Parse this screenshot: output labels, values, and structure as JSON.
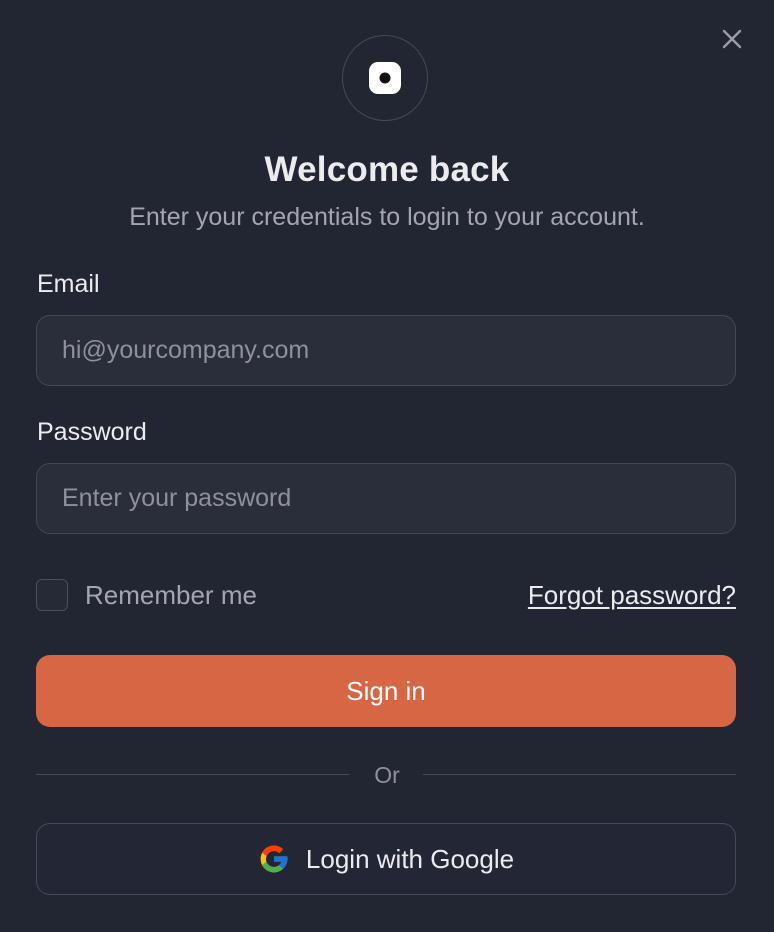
{
  "dialog": {
    "title": "Welcome back",
    "subtitle": "Enter your credentials to login to your account.",
    "close_icon": "close-icon",
    "logo_icon": "logo-icon"
  },
  "form": {
    "email": {
      "label": "Email",
      "value": "",
      "placeholder": "hi@yourcompany.com"
    },
    "password": {
      "label": "Password",
      "value": "",
      "placeholder": "Enter your password"
    },
    "remember_me": {
      "label": "Remember me",
      "checked": false
    },
    "forgot_password_label": "Forgot password?",
    "submit_label": "Sign in",
    "divider_label": "Or",
    "google": {
      "label": "Login with Google",
      "icon": "google-icon"
    }
  },
  "colors": {
    "background": "#222633",
    "primary_button": "#d66644",
    "text": "#ececef",
    "muted_text": "#a3a6af",
    "input_background": "#2a2e3b",
    "border": "#444856"
  }
}
